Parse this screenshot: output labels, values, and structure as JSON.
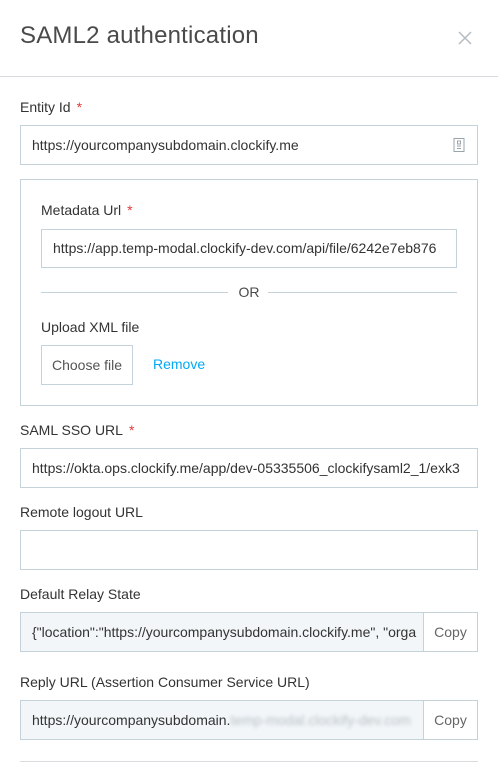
{
  "modal": {
    "title": "SAML2 authentication",
    "close_icon": "close-icon"
  },
  "entity_id": {
    "label": "Entity Id",
    "required_mark": "*",
    "value": "https://yourcompanysubdomain.clockify.me",
    "icon": "document-icon"
  },
  "metadata": {
    "label": "Metadata Url",
    "required_mark": "*",
    "value": "https://app.temp-modal.clockify-dev.com/api/file/6242e7eb876",
    "or_text": "OR",
    "upload_label": "Upload XML file",
    "choose_file_label": "Choose file",
    "remove_label": "Remove"
  },
  "saml_sso": {
    "label": "SAML SSO URL",
    "required_mark": "*",
    "value": "https://okta.ops.clockify.me/app/dev-05335506_clockifysaml2_1/exk3"
  },
  "remote_logout": {
    "label": "Remote logout URL",
    "value": ""
  },
  "relay_state": {
    "label": "Default Relay State",
    "value": "{\"location\":\"https://yourcompanysubdomain.clockify.me\", \"orga",
    "copy_label": "Copy"
  },
  "reply_url": {
    "label": "Reply URL (Assertion Consumer Service URL)",
    "value_visible": "https://yourcompanysubdomain.",
    "value_blurred": "temp-modal.clockify-dev.com",
    "copy_label": "Copy"
  },
  "colors": {
    "accent": "#03a9f4",
    "required": "#e33b3b",
    "border": "#c6d2d9",
    "readonly_bg": "#f2f6f8"
  }
}
